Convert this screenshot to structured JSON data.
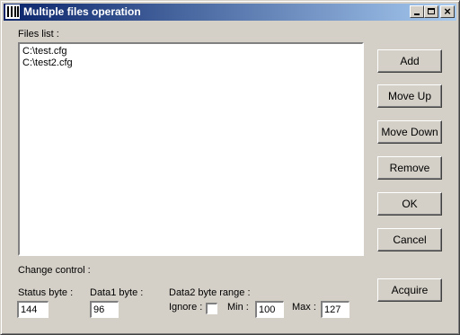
{
  "window": {
    "title": "Multiple files operation",
    "app_icon": "piano-keys-icon"
  },
  "files": {
    "label": "Files list :",
    "items": [
      "C:\\test.cfg",
      "C:\\test2.cfg"
    ]
  },
  "buttons": {
    "add": "Add",
    "move_up": "Move Up",
    "move_down": "Move Down",
    "remove": "Remove",
    "ok": "OK",
    "cancel": "Cancel",
    "acquire": "Acquire"
  },
  "change_control": {
    "label": "Change control :",
    "status_label": "Status byte :",
    "status_value": "144",
    "data1_label": "Data1 byte :",
    "data1_value": "96",
    "data2_label": "Data2 byte range :",
    "ignore_label": "Ignore :",
    "ignore_checked": false,
    "min_label": "Min :",
    "min_value": "100",
    "max_label": "Max :",
    "max_value": "127"
  }
}
